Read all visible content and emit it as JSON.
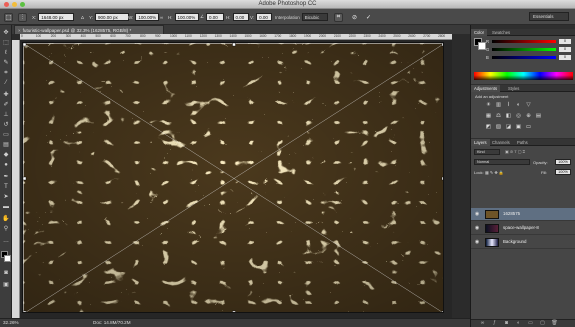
{
  "window": {
    "title": "Adobe Photoshop CC"
  },
  "options_bar": {
    "x_label": "X:",
    "x_value": "1648.00 px",
    "delta_label": "Δ",
    "y_label": "Y:",
    "y_value": "900.00 px",
    "w_label": "W:",
    "w_value": "100.00%",
    "link_icon": "chain",
    "h_label": "H:",
    "h_value": "100.00%",
    "angle_label": "∠",
    "angle_value": "0.00",
    "hskew_label": "H:",
    "hskew_value": "0.00",
    "vskew_label": "V:",
    "vskew_value": "0.00",
    "interp_label": "Interpolation",
    "interp_value": "Bicubic",
    "cancel_icon": "cancel",
    "commit_icon": "check",
    "workspace": "Essentials"
  },
  "document": {
    "tab_title": "futuristic-wallpaper.psd @ 32.3% (1628575, RGB/8) *",
    "zoom": "32.26%",
    "doc_info": "Doc: 14.8M/70.2M"
  },
  "ruler_ticks": [
    "0",
    "100",
    "200",
    "300",
    "400",
    "500",
    "600",
    "700",
    "800",
    "900",
    "1000",
    "1100",
    "1200",
    "1300",
    "1400",
    "1500",
    "1600",
    "1700",
    "1800",
    "1900",
    "2000",
    "2100",
    "2200",
    "2300",
    "2400",
    "2500",
    "2600",
    "2700",
    "2800"
  ],
  "color_panel": {
    "tabs": [
      "Color",
      "Swatches"
    ],
    "r_label": "R",
    "r_value": "0",
    "g_label": "G",
    "g_value": "0",
    "b_label": "B",
    "b_value": "0"
  },
  "adjustments_panel": {
    "tabs": [
      "Adjustments",
      "Styles"
    ],
    "heading": "Add an adjustment"
  },
  "layers_panel": {
    "tabs": [
      "Layers",
      "Channels",
      "Paths"
    ],
    "filter_kind": "Kind",
    "blend_mode": "Normal",
    "opacity_label": "Opacity:",
    "opacity_value": "100%",
    "lock_label": "Lock:",
    "fill_label": "Fill:",
    "fill_value": "100%",
    "layers": [
      {
        "name": "1628575",
        "selected": true
      },
      {
        "name": "space-wallpaper-8",
        "selected": false
      },
      {
        "name": "Background",
        "selected": false
      }
    ]
  },
  "colors": {
    "accent_selected": "#5f6f82",
    "panel_bg": "#464646"
  }
}
